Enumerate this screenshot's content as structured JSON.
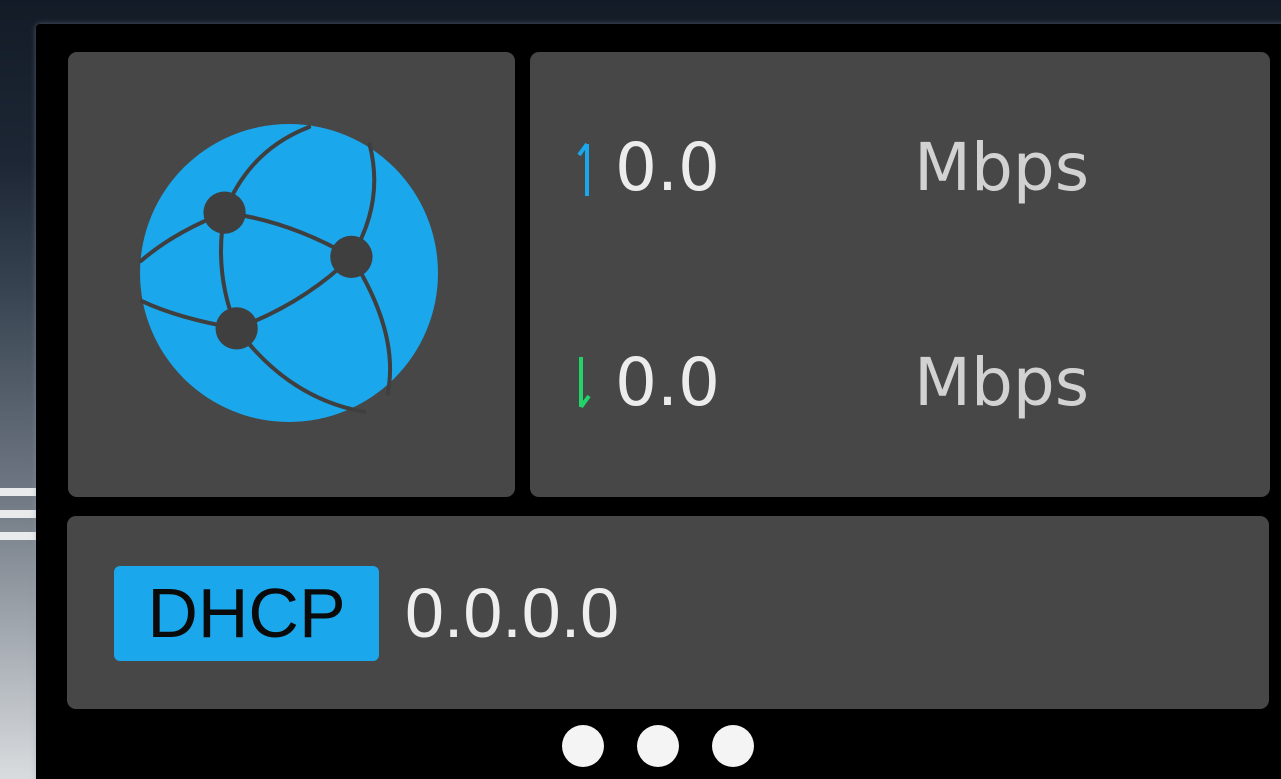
{
  "connection": {
    "upload": {
      "value": "0.0",
      "unit": "Mbps",
      "arrow_icon": "upload-arrow-icon",
      "color": "#1aa7eb"
    },
    "download": {
      "value": "0.0",
      "unit": "Mbps",
      "arrow_icon": "download-arrow-icon",
      "color": "#22d36a"
    },
    "mode_badge": "DHCP",
    "ip_address": "0.0.0.0",
    "status_icon": "globe-network-icon",
    "accent_color": "#1aa7eb"
  },
  "pager": {
    "pages": 3
  }
}
